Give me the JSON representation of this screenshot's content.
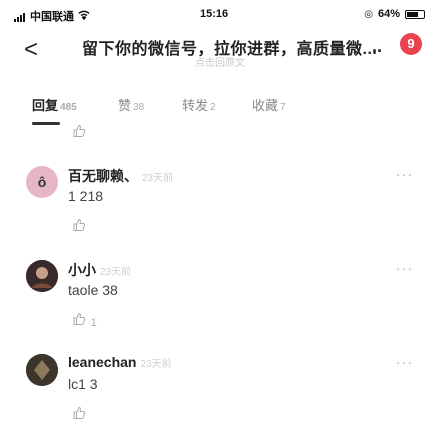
{
  "status_bar": {
    "carrier": "中国联通",
    "wifi": "wifi-icon",
    "time": "15:16",
    "battery": "64%"
  },
  "nav": {
    "back": "<",
    "title": "留下你的微信号，拉你进群，高质量微...",
    "subtitle": "点击回原文",
    "more": "..",
    "badge": "9"
  },
  "tabs": [
    {
      "label": "回复",
      "count": "485"
    },
    {
      "label": "赞",
      "count": "38"
    },
    {
      "label": "转发",
      "count": "2"
    },
    {
      "label": "收藏",
      "count": "7"
    }
  ],
  "comments": [
    {
      "name": "百无聊赖、",
      "time": "23天前",
      "text": "1         218",
      "likes": "",
      "avatar_color": "#e7b6c6",
      "avatar_glyph": "ô"
    },
    {
      "name": "小小",
      "time": "23天前",
      "text": "taole     38",
      "likes": "1",
      "avatar_color": "#3a2a2a",
      "avatar_glyph": ""
    },
    {
      "name": "leanechan",
      "time": "23天前",
      "text": "lc1      3",
      "likes": "",
      "avatar_color": "#3b352c",
      "avatar_glyph": ""
    }
  ],
  "icons": {
    "like": "thumb-up-icon",
    "more": "more-dots-icon"
  }
}
